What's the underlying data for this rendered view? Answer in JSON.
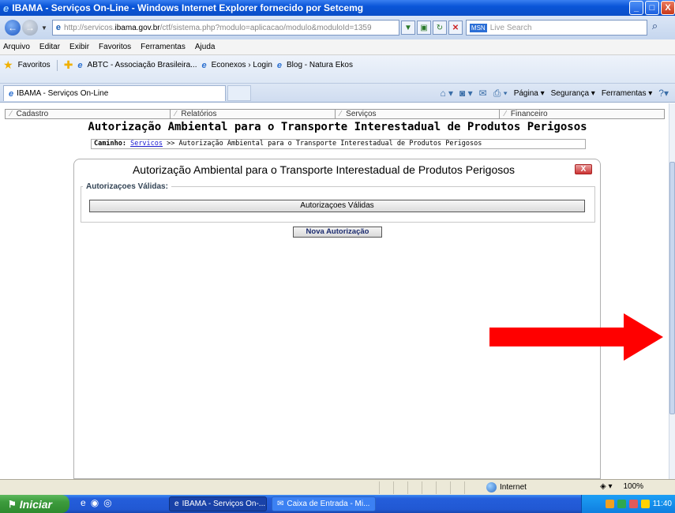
{
  "window": {
    "title": "IBAMA - Serviços On-Line - Windows Internet Explorer fornecido por Setcemg",
    "buttons": {
      "minimize": "_",
      "maximize": "□",
      "close": "X"
    }
  },
  "address": {
    "url_prefix": "http://servicos.",
    "url_domain": "ibama.gov.br",
    "url_path": "/ctf/sistema.php?modulo=aplicacao/modulo&moduloId=1359",
    "search_placeholder": "Live Search",
    "search_brand": "MSN"
  },
  "menu": [
    "Arquivo",
    "Editar",
    "Exibir",
    "Favoritos",
    "Ferramentas",
    "Ajuda"
  ],
  "favorites": {
    "label": "Favoritos",
    "links": [
      "ABTC - Associação Brasileira...",
      "Econexos › Login",
      "Blog - Natura Ekos"
    ]
  },
  "tab": {
    "label": "IBAMA - Serviços On-Line"
  },
  "commands": [
    "Página ▾",
    "Segurança ▾",
    "Ferramentas ▾"
  ],
  "site_nav": [
    "Cadastro",
    "Relatórios",
    "Serviços",
    "Financeiro"
  ],
  "page": {
    "heading": "Autorização Ambiental para o Transporte Interestadual de Produtos Perigosos",
    "breadcrumb_label": "Caminho:",
    "breadcrumb_link": "Servicos",
    "breadcrumb_rest": " >> Autorização Ambiental para o Transporte Interestadual de Produtos Perigosos"
  },
  "panel": {
    "title": "Autorização Ambiental para o Transporte Interestadual de Produtos Perigosos",
    "close_label": "X",
    "fieldset_legend": "Autorizaçoes Válidas:",
    "list_button": "Autorizaçoes Válidas",
    "new_button": "Nova Autorização"
  },
  "status": {
    "zone": "Internet",
    "zoom": "100%"
  },
  "taskbar": {
    "start": "Iniciar",
    "items": [
      "IBAMA - Serviços On-...",
      "Caixa de Entrada - Mi..."
    ],
    "clock": "11:40"
  },
  "colors": {
    "arrow": "#ff0000",
    "titlebar": "#0a55d8",
    "start": "#3c9b3c"
  }
}
